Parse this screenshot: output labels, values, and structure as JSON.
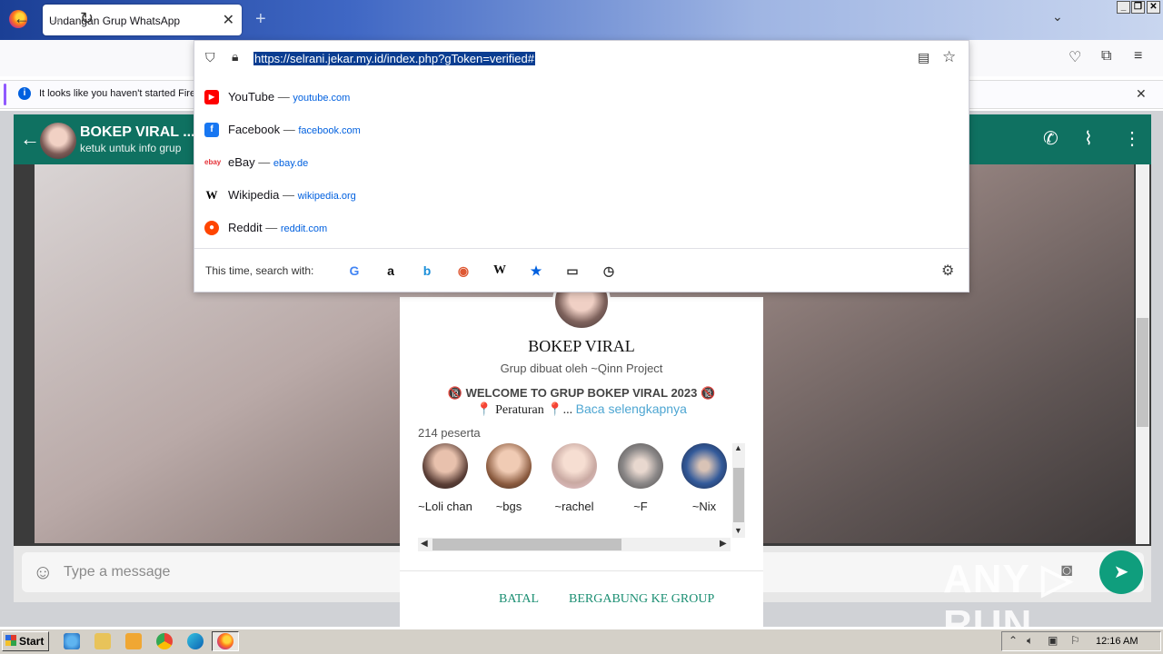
{
  "browser": {
    "tab_title": "Undangan Grup WhatsApp",
    "tab_close": "✕",
    "new_tab": "+",
    "url": "https://selrani.jekar.my.id/index.php?gToken=verified#",
    "notification_text": "It looks like you haven't started Firefox in a while",
    "notification_close": "✕"
  },
  "url_dropdown": {
    "suggestions": [
      {
        "name": "YouTube",
        "dash": " — ",
        "domain": "youtube.com",
        "icon": "youtube-icon",
        "color": "#ff0000"
      },
      {
        "name": "Facebook",
        "dash": " — ",
        "domain": "facebook.com",
        "icon": "facebook-icon",
        "color": "#1877f2"
      },
      {
        "name": "eBay",
        "dash": " — ",
        "domain": "ebay.de",
        "icon": "ebay-icon",
        "color": "#e53238"
      },
      {
        "name": "Wikipedia",
        "dash": " — ",
        "domain": "wikipedia.org",
        "icon": "wikipedia-icon",
        "color": "#000000"
      },
      {
        "name": "Reddit",
        "dash": " — ",
        "domain": "reddit.com",
        "icon": "reddit-icon",
        "color": "#ff4500"
      }
    ],
    "search_with_label": "This time, search with:",
    "engines": [
      "google-icon",
      "amazon-icon",
      "bing-icon",
      "duckduckgo-icon",
      "wikipedia-icon",
      "bookmarks-icon",
      "tabs-icon",
      "history-icon"
    ]
  },
  "whatsapp": {
    "group_name": "BOKEP VIRAL ...",
    "group_subtitle": "ketuk untuk info grup",
    "message_placeholder": "Type a message"
  },
  "modal": {
    "title": "BOKEP VIRAL",
    "creator": "Grup dibuat oleh ~Qinn Project",
    "welcome": "🔞 WELCOME TO GRUP BOKEP VIRAL 2023 🔞",
    "rules": "📍 Peraturan 📍...",
    "read_more": "Baca selengkapnya",
    "participants": "214 peserta",
    "members": [
      {
        "name": "~Loli chan"
      },
      {
        "name": "~bgs"
      },
      {
        "name": "~rachel"
      },
      {
        "name": "~F"
      },
      {
        "name": "~Nix"
      }
    ],
    "cancel": "BATAL",
    "join": "BERGABUNG KE GROUP"
  },
  "taskbar": {
    "start": "Start",
    "clock": "12:16 AM"
  },
  "watermark": "ANY ▷ RUN",
  "colors": {
    "whatsapp_green": "#0f7161",
    "button_green": "#1c8f73",
    "link_blue": "#4ea6d2",
    "url_highlight": "#0a3d91"
  }
}
